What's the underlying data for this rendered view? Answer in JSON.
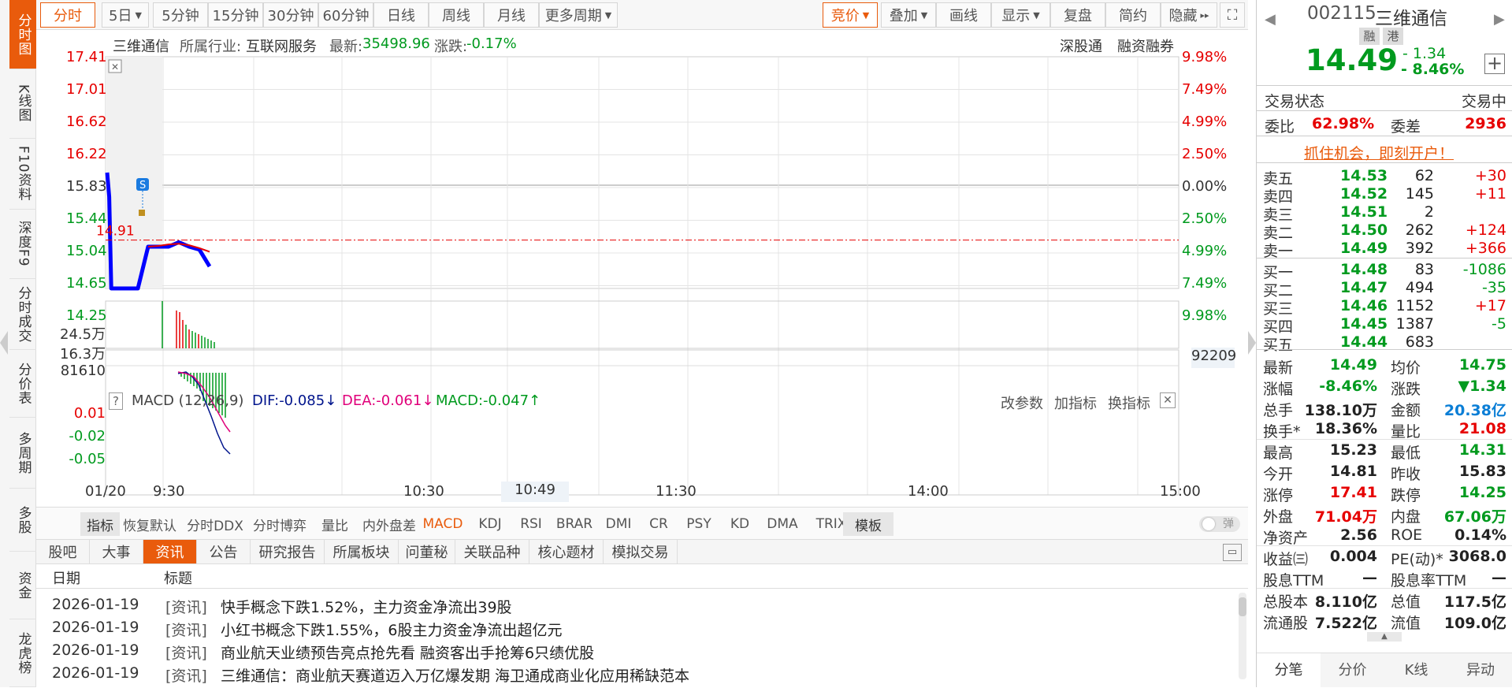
{
  "sidebar": {
    "items": [
      "分时图",
      "K线图",
      "F10资料",
      "深度F9",
      "分时成交",
      "分价表",
      "多周期",
      "多股",
      "资金",
      "龙虎榜"
    ]
  },
  "toolbar": {
    "left": [
      "分时",
      "5日",
      "5分钟",
      "15分钟",
      "30分钟",
      "60分钟",
      "日线",
      "周线",
      "月线",
      "更多周期"
    ],
    "right": [
      "竞价",
      "叠加",
      "画线",
      "显示",
      "复盘",
      "简约",
      "隐藏"
    ]
  },
  "chart_header": {
    "name": "三维通信",
    "industry_label": "所属行业:",
    "industry": "互联网服务",
    "latest_label": "最新:",
    "latest": "35498.96",
    "change_label": "涨跌:",
    "change": "-0.17%",
    "link1": "深股通",
    "link2": "融资融券"
  },
  "chart_data": {
    "type": "line",
    "title": "三维通信 分时",
    "price_ticks": [
      "17.41",
      "17.01",
      "16.62",
      "16.22",
      "15.83",
      "15.44",
      "15.04",
      "14.65",
      "14.25"
    ],
    "pct_ticks": [
      "9.98%",
      "7.49%",
      "4.99%",
      "2.50%",
      "0.00%",
      "2.50%",
      "4.99%",
      "7.49%",
      "9.98%"
    ],
    "x_ticks": [
      "01/20",
      "9:30",
      "10:30",
      "11:30",
      "14:00",
      "15:00"
    ],
    "cursor_time": "10:49",
    "ylim": [
      14.25,
      17.41
    ],
    "prev_close": 15.83,
    "marker_price": "14.91",
    "marker_label": "S",
    "series": [
      {
        "name": "价格",
        "color": "#0000ff",
        "x": [
          0,
          1,
          2,
          3,
          4,
          5,
          10,
          15,
          20,
          25,
          30,
          35,
          40,
          45,
          50
        ],
        "y": [
          15.83,
          15.5,
          14.25,
          14.25,
          14.25,
          14.25,
          14.25,
          14.25,
          14.82,
          14.82,
          14.82,
          14.88,
          14.82,
          14.78,
          14.55
        ]
      },
      {
        "name": "均价",
        "color": "#e60000",
        "x": [
          20,
          25,
          30,
          35,
          40,
          45,
          50
        ],
        "y": [
          14.82,
          14.83,
          14.85,
          14.86,
          14.84,
          14.8,
          14.75
        ]
      }
    ],
    "volume_ticks": [
      "24.5万",
      "16.3万",
      "81610"
    ],
    "volume_value": "92209",
    "macd": {
      "label": "MACD (12,26,9)",
      "dif": "DIF:-0.085↓",
      "dea": "DEA:-0.061↓",
      "macd": "MACD:-0.047↑",
      "ticks": [
        "0.01",
        "-0.02",
        "-0.05"
      ],
      "links": [
        "改参数",
        "加指标",
        "换指标"
      ]
    }
  },
  "indicators": [
    "指标",
    "恢复默认",
    "分时DDX",
    "分时博弈",
    "量比",
    "内外盘差",
    "MACD",
    "KDJ",
    "RSI",
    "BRAR",
    "DMI",
    "CR",
    "PSY",
    "KD",
    "DMA",
    "TRIX",
    "模板"
  ],
  "toggle_label": "弹",
  "news": {
    "tabs": [
      "股吧",
      "大事",
      "资讯",
      "公告",
      "研究报告",
      "所属板块",
      "问董秘",
      "关联品种",
      "核心题材",
      "模拟交易"
    ],
    "headers": [
      "日期",
      "标题"
    ],
    "rows": [
      {
        "date": "2026-01-19",
        "tag": "[资讯]",
        "title": "快手概念下跌1.52%，主力资金净流出39股"
      },
      {
        "date": "2026-01-19",
        "tag": "[资讯]",
        "title": "小红书概念下跌1.55%，6股主力资金净流出超亿元"
      },
      {
        "date": "2026-01-19",
        "tag": "[资讯]",
        "title": "商业航天业绩预告亮点抢先看 融资客出手抢筹6只绩优股"
      },
      {
        "date": "2026-01-19",
        "tag": "[资讯]",
        "title": "三维通信：商业航天赛道迈入万亿爆发期 海卫通成商业化应用稀缺范本"
      }
    ]
  },
  "quote": {
    "code": "002115",
    "name": "三维通信",
    "badge1": "融",
    "badge2": "港",
    "price": "14.49",
    "chg": "- 1.34",
    "pct": "- 8.46%",
    "status_label": "交易状态",
    "status": "交易中",
    "weibi_label": "委比",
    "weibi": "62.98%",
    "weicha_label": "委差",
    "weicha": "2936",
    "promo": "抓住机会，即刻开户！",
    "asks": [
      {
        "l": "卖五",
        "p": "14.53",
        "v": "62",
        "d": "+30"
      },
      {
        "l": "卖四",
        "p": "14.52",
        "v": "145",
        "d": "+11"
      },
      {
        "l": "卖三",
        "p": "14.51",
        "v": "2",
        "d": ""
      },
      {
        "l": "卖二",
        "p": "14.50",
        "v": "262",
        "d": "+124"
      },
      {
        "l": "卖一",
        "p": "14.49",
        "v": "392",
        "d": "+366"
      }
    ],
    "bids": [
      {
        "l": "买一",
        "p": "14.48",
        "v": "83",
        "d": "-1086"
      },
      {
        "l": "买二",
        "p": "14.47",
        "v": "494",
        "d": "-35"
      },
      {
        "l": "买三",
        "p": "14.46",
        "v": "1152",
        "d": "+17"
      },
      {
        "l": "买四",
        "p": "14.45",
        "v": "1387",
        "d": "-5"
      },
      {
        "l": "买五",
        "p": "14.44",
        "v": "683",
        "d": ""
      }
    ],
    "stats": [
      [
        "最新",
        "14.49",
        "均价",
        "14.75"
      ],
      [
        "涨幅",
        "-8.46%",
        "涨跌",
        "▼1.34"
      ],
      [
        "总手",
        "138.10万",
        "金额",
        "20.38亿"
      ],
      [
        "换手*",
        "18.36%",
        "量比",
        "21.08"
      ],
      [
        "最高",
        "15.23",
        "最低",
        "14.31"
      ],
      [
        "今开",
        "14.81",
        "昨收",
        "15.83"
      ],
      [
        "涨停",
        "17.41",
        "跌停",
        "14.25"
      ],
      [
        "外盘",
        "71.04万",
        "内盘",
        "67.06万"
      ],
      [
        "净资产",
        "2.56",
        "ROE",
        "0.14%"
      ],
      [
        "收益㈢",
        "0.004",
        "PE(动)*",
        "3068.0"
      ],
      [
        "股息TTM",
        "—",
        "股息率TTM",
        "—"
      ],
      [
        "总股本",
        "8.110亿",
        "总值",
        "117.5亿"
      ],
      [
        "流通股",
        "7.522亿",
        "流值",
        "109.0亿"
      ]
    ],
    "bottom_tabs": [
      "分笔",
      "分价",
      "K线",
      "异动"
    ]
  }
}
